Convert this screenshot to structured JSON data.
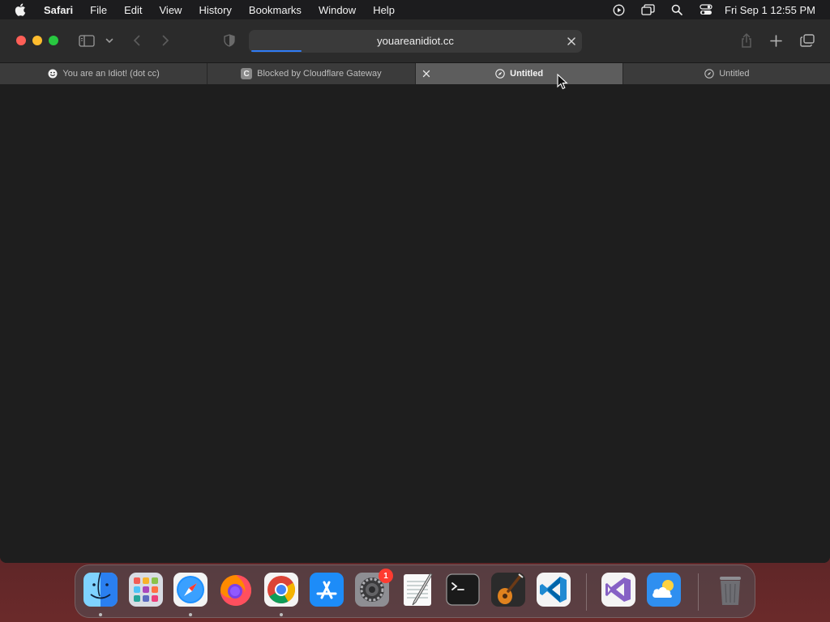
{
  "menubar": {
    "app_name": "Safari",
    "items": [
      "File",
      "Edit",
      "View",
      "History",
      "Bookmarks",
      "Window",
      "Help"
    ],
    "clock": "Fri Sep 1  12:55 PM"
  },
  "address_bar": {
    "url": "youareanidiot.cc",
    "load_progress": 0.15
  },
  "tabs": [
    {
      "title": "You are an Idiot! (dot cc)",
      "icon": "smiley-icon",
      "active": false
    },
    {
      "title": "Blocked by Cloudflare Gateway",
      "icon": "c-letter-icon",
      "icon_letter": "C",
      "active": false
    },
    {
      "title": "Untitled",
      "icon": "compass-icon",
      "active": true
    },
    {
      "title": "Untitled",
      "icon": "compass-icon",
      "active": false
    }
  ],
  "dock": {
    "apps": [
      "Finder",
      "Launchpad",
      "Safari",
      "Firefox",
      "Chrome",
      "App Store",
      "System Settings",
      "TextEdit",
      "Terminal",
      "GarageBand",
      "Visual Studio Code",
      "Visual Studio",
      "Weather",
      "Trash"
    ],
    "system_settings_badge": "1"
  },
  "colors": {
    "accent": "#2f7bf6",
    "close_red": "#ff5f57",
    "minimize_yellow": "#febc2e",
    "zoom_green": "#28c840"
  }
}
